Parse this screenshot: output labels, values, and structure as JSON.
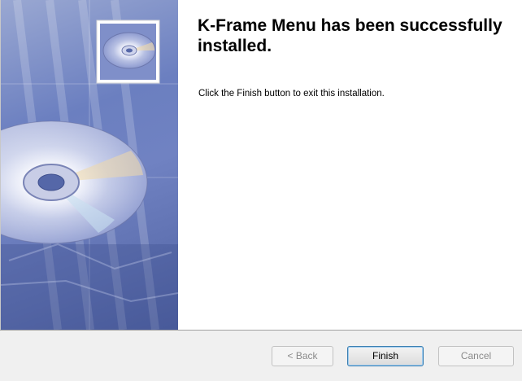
{
  "dialog": {
    "title": "K-Frame Menu has been successfully installed.",
    "message": "Click the Finish button to exit this installation."
  },
  "buttons": {
    "back_label": "< Back",
    "finish_label": "Finish",
    "cancel_label": "Cancel"
  },
  "side_art": {
    "icon": "cd-disc-icon",
    "thumbnail_icon": "cd-disc-thumbnail-icon"
  },
  "colors": {
    "art_blue": "#6b7fc0",
    "button_bar": "#f0f0f0",
    "default_button_border": "#3c7fb1",
    "disabled_text": "#8a8a8a"
  }
}
